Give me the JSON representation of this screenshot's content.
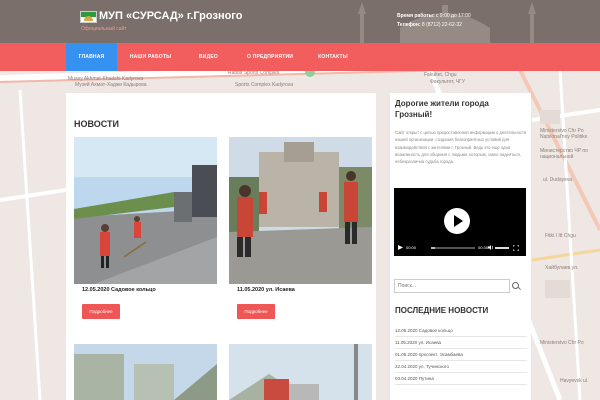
{
  "header": {
    "site_title": "МУП «СУРСАД» г.Грозного",
    "site_subtitle": "Официальный сайт",
    "hours_label": "Время работы:",
    "hours_value": "с 9:00 до 17:00",
    "phone_label": "Телефон:",
    "phone_value": "8 (8712) 22-62-32",
    "logo_icon": "flag-logo-icon"
  },
  "nav": {
    "items": [
      {
        "label": "Главная",
        "active": true
      },
      {
        "label": "Наши работы",
        "active": false
      },
      {
        "label": "Видео",
        "active": false
      },
      {
        "label": "О предприятии",
        "active": false
      },
      {
        "label": "Контакты",
        "active": false
      }
    ]
  },
  "map_labels": [
    "Musey Akhmat-Khadzhi Kadyrova",
    "Музей Ахмат-Хаджи Кадырова",
    "Rabbit Sports Complex",
    "Sports Complex Kadyrova",
    "Fakultet, Chgu",
    "Факультет, ЧГУ",
    "Ministerstvo Chr Po Natsional'noy Politike",
    "Министерство ЧР по национальной",
    "Ministerstvo Chr Po",
    "Fitki I Itt Chgu",
    "Хайбулаев ул.",
    "ul. Dudayeva",
    "Havyevsk ul."
  ],
  "main": {
    "section_title": "Новости",
    "cards": [
      {
        "date": "12.05.2020 Садовое кольцо",
        "button": "Подробнее"
      },
      {
        "date": "11.05.2020 ул. Исаева",
        "button": "Подробнее"
      },
      {
        "date": "",
        "button": ""
      },
      {
        "date": "",
        "button": ""
      }
    ]
  },
  "sidebar": {
    "title": "Дорогие жители города Грозный!",
    "text": "Сайт открыт с целью предоставления информации о деятельности нашей организации, создания благоприятных условий для взаимодействия с жителями г. Грозный. Ведь это еще одна возможность для общения с людьми, которым, смею надеяться, небезразлична судьба города.",
    "video": {
      "current_time": "00:00",
      "duration": "00:35",
      "progress": 0.1
    },
    "search": {
      "placeholder": "Поиск..."
    },
    "recent_title": "Последние новости",
    "recent_items": [
      "12.05.2020 Садовое кольцо",
      "11.05.2020 ул. Исаева",
      "01.05.2020 проспект. Эсамбаева",
      "22.04.2020 ул. Тучинского",
      "03.04.2020 Путина"
    ]
  },
  "colors": {
    "header_bg": "#7b6f6b",
    "nav_bg": "#f25d5d",
    "nav_active": "#3592f0",
    "button_bg": "#ee5755",
    "title_white": "#ffffff"
  }
}
